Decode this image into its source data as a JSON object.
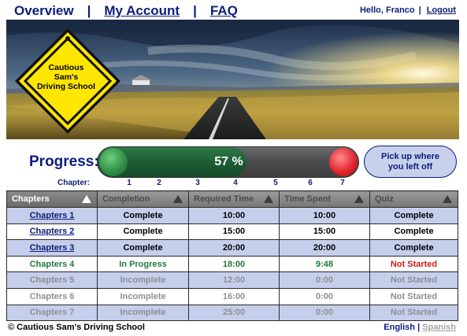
{
  "nav": {
    "overview": "Overview",
    "sep1": "|",
    "my_account": "My Account",
    "sep2": "|",
    "faq": "FAQ"
  },
  "user": {
    "greeting": "Hello, Franco",
    "sep": "|",
    "logout": "Logout"
  },
  "brand": {
    "sign_line1": "Cautious",
    "sign_line2": "Sam's",
    "sign_line3": "Driving School",
    "sign_color": "#ffe600"
  },
  "progress": {
    "label": "Progress:",
    "percent_text": "57 %",
    "percent_value": 0.57,
    "pickup_line1": "Pick up where",
    "pickup_line2": "you left off",
    "chapter_label": "Chapter:",
    "chapters": [
      "1",
      "2",
      "3",
      "4",
      "5",
      "6",
      "7"
    ]
  },
  "table": {
    "headers": [
      "Chapters",
      "Completion",
      "Required Time",
      "Time Spent",
      "Quiz"
    ],
    "rows": [
      {
        "chapter": "Chapters 1",
        "completion": "Complete",
        "required": "10:00",
        "spent": "10:00",
        "quiz": "Complete",
        "state": "done"
      },
      {
        "chapter": "Chapters 2",
        "completion": "Complete",
        "required": "15:00",
        "spent": "15:00",
        "quiz": "Complete",
        "state": "done"
      },
      {
        "chapter": "Chapters 3",
        "completion": "Complete",
        "required": "20:00",
        "spent": "20:00",
        "quiz": "Complete",
        "state": "done"
      },
      {
        "chapter": "Chapters 4",
        "completion": "In Progress",
        "required": "18:00",
        "spent": "9:48",
        "quiz": "Not Started",
        "state": "current"
      },
      {
        "chapter": "Chapters 5",
        "completion": "Incomplete",
        "required": "12:00",
        "spent": "0:00",
        "quiz": "Not Started",
        "state": "locked"
      },
      {
        "chapter": "Chapters 6",
        "completion": "Incomplete",
        "required": "16:00",
        "spent": "0:00",
        "quiz": "Not Started",
        "state": "locked"
      },
      {
        "chapter": "Chapters 7",
        "completion": "Incomplete",
        "required": "25:00",
        "spent": "0:00",
        "quiz": "Not Started",
        "state": "locked"
      }
    ]
  },
  "footer": {
    "copyright_symbol": "©",
    "copyright": "Cautious Sam's Driving School",
    "lang_en": "English",
    "lang_sep": "|",
    "lang_es": "Spanish"
  },
  "colors": {
    "nav_blue": "#0b1e7a",
    "progress_green": "#1d5a33",
    "row_blue": "#c5cfec",
    "in_progress_green": "#1f7a3b",
    "not_started_red": "#d21c1c"
  }
}
